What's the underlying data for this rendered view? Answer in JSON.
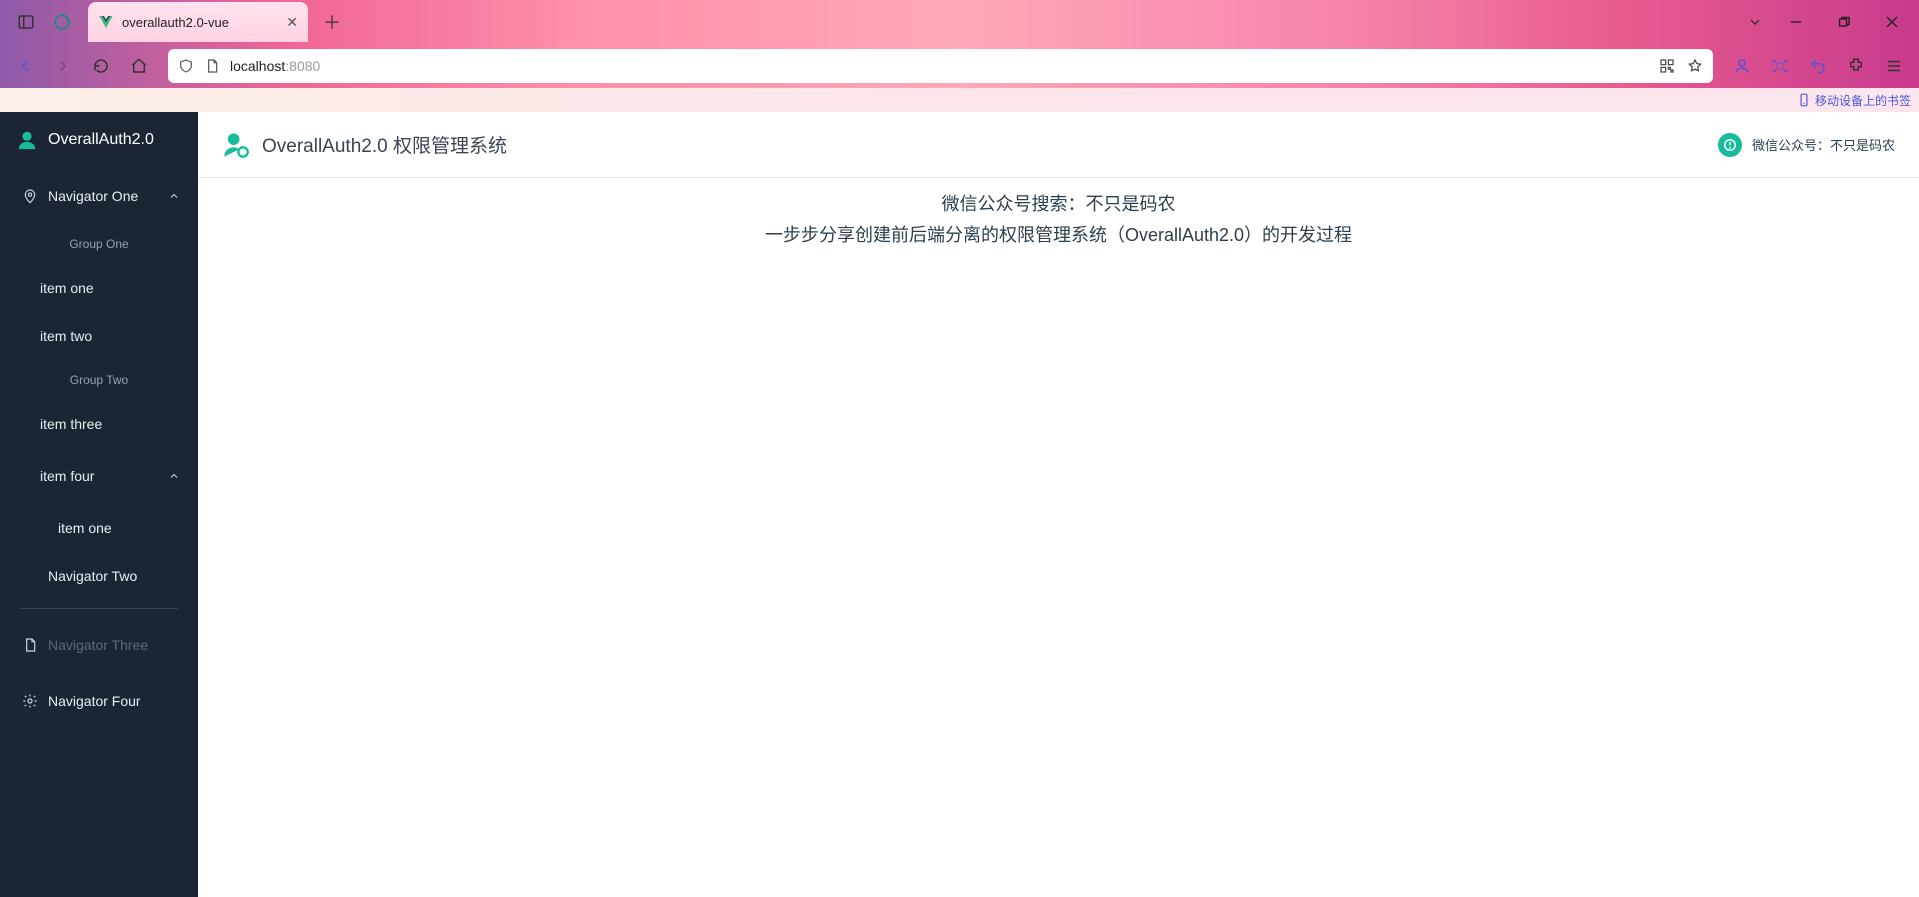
{
  "browser": {
    "tab_title": "overallauth2.0-vue",
    "url_host": "localhost",
    "url_port": ":8080",
    "bookmark_label": "移动设备上的书签"
  },
  "sidebar": {
    "brand": "OverallAuth2.0",
    "nav1_label": "Navigator One",
    "group1": "Group One",
    "item1": "item one",
    "item2": "item two",
    "group2": "Group Two",
    "item3": "item three",
    "item4_label": "item four",
    "item4_sub1": "item one",
    "nav2_label": "Navigator Two",
    "nav3_label": "Navigator Three",
    "nav4_label": "Navigator Four"
  },
  "header": {
    "title": "OverallAuth2.0 权限管理系统",
    "right_label": "微信公众号：不只是码农"
  },
  "content": {
    "line1": "微信公众号搜索：不只是码农",
    "line2": "一步步分享创建前后端分离的权限管理系统（OverallAuth2.0）的开发过程"
  }
}
